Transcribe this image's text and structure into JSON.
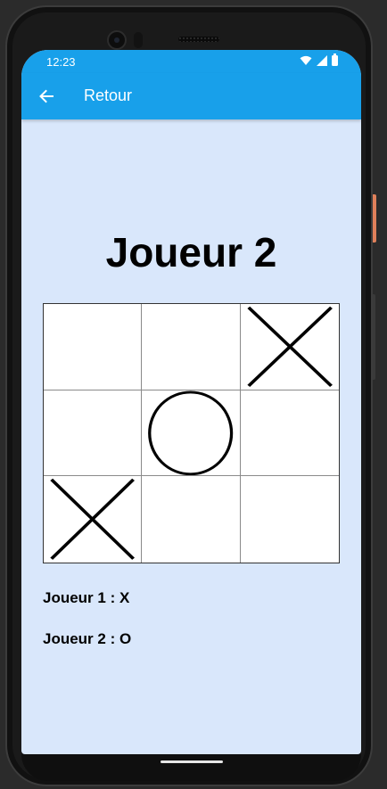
{
  "status_bar": {
    "time": "12:23"
  },
  "app_bar": {
    "back_icon": "arrow-left-icon",
    "title": "Retour"
  },
  "game": {
    "current_player_title": "Joueur 2",
    "board": [
      "",
      "",
      "X",
      "",
      "O",
      "",
      "X",
      "",
      ""
    ]
  },
  "legend": {
    "player1": "Joueur 1 : X",
    "player2": "Joueur 2 : O"
  },
  "colors": {
    "app_bar": "#18a0ea",
    "background": "#d9e7fb",
    "board": "#ffffff",
    "marks": "#000000"
  }
}
